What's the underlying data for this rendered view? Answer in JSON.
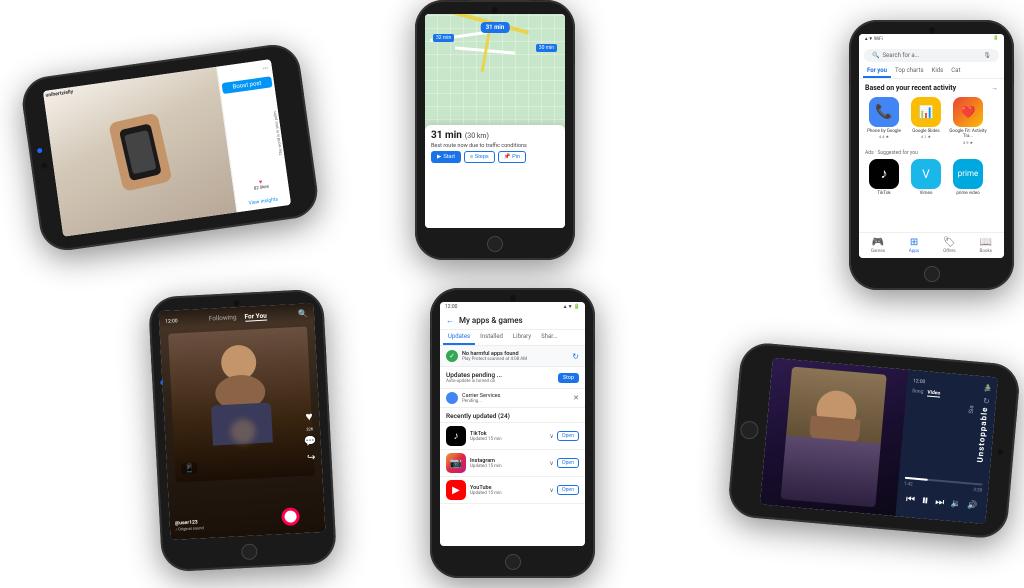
{
  "phones": {
    "instagram": {
      "username": "unihertzielly",
      "tagline": "The world is in your palm.",
      "boost_label": "Boost post",
      "insights_label": "View insights",
      "likes": "82 likes"
    },
    "maps": {
      "duration": "31 min",
      "distance": "(30 km)",
      "route_info": "31 min",
      "route_detail": "Best route now due to traffic conditions",
      "btn_start": "Start",
      "btn_steps": "Steps",
      "btn_pin": "Pin",
      "time_badge": "31 min",
      "route2": "32 min",
      "route3": "30 min"
    },
    "playstore": {
      "search_placeholder": "Search for a...",
      "tab_for_you": "For you",
      "tab_top_charts": "Top charts",
      "tab_kids": "Kids",
      "tab_cat": "Cat",
      "section_title": "Based on your recent activity",
      "apps_section_title": "Ads · Suggested for you",
      "apps": [
        {
          "name": "Phone by Google",
          "rating": "4.4 ★"
        },
        {
          "name": "Google Slides",
          "rating": "4.1 ★"
        },
        {
          "name": "Google Fit: Activity Tra...",
          "rating": "3.9 ★"
        }
      ],
      "suggested": [
        "TikTok",
        "Vimeo",
        "prime video"
      ],
      "nav_games": "Games",
      "nav_apps": "Apps",
      "nav_offers": "Offers",
      "nav_books": "Books"
    },
    "tiktok": {
      "tab_following": "Following",
      "tab_for_you": "For You",
      "status": "12:00"
    },
    "myapps": {
      "title": "My apps & games",
      "tab_updates": "Updates",
      "tab_installed": "Installed",
      "tab_library": "Library",
      "tab_share": "Shar...",
      "protect_title": "No harmful apps found",
      "protect_sub": "Play Protect scanned at 4:08 AM",
      "updates_pending": "Updates pending ...",
      "auto_update": "Auto-update is turned on",
      "stop_btn": "Stop",
      "carrier_name": "Carrier Services",
      "carrier_status": "Pending...",
      "recently_updated": "Recently updated (24)",
      "apps": [
        {
          "name": "TikTok",
          "updated": "Updated 15 min",
          "btn": "Open"
        },
        {
          "name": "Instagram",
          "updated": "Updated 15 min",
          "btn": "Open"
        },
        {
          "name": "YouTube",
          "updated": "Updated 15 min",
          "btn": "Open"
        }
      ],
      "status_left": "12:00",
      "status_right": "▲▼ 🔋"
    },
    "music": {
      "title": "Unstoppable",
      "artist": "Sia",
      "tab_song": "Song",
      "tab_video": "Video",
      "progress_current": "1:42",
      "progress_total": "3:28",
      "status": "12:00"
    }
  }
}
